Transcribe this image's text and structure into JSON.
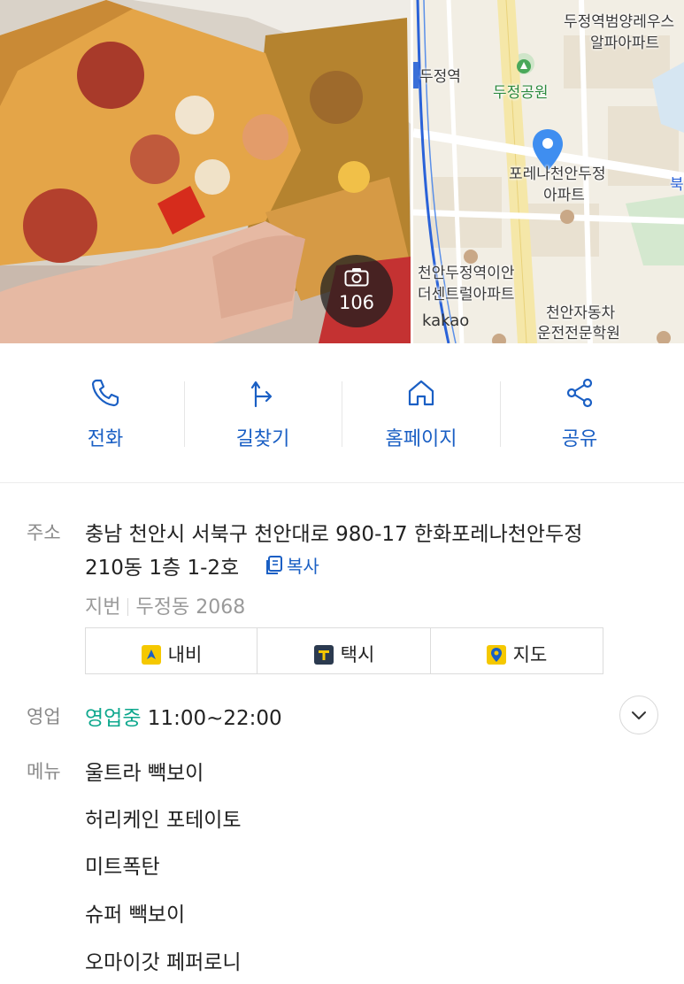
{
  "hero": {
    "photo_count": "106",
    "map": {
      "labels": [
        "두정역범양레우스",
        "알파아파트",
        "두정역",
        "두정공원",
        "포레나천안두정",
        "아파트",
        "천안두정역이안",
        "더센트럴아파트",
        "천안자동차",
        "운전전문학원",
        "북"
      ],
      "watermark": "kakao"
    }
  },
  "actions": [
    {
      "label": "전화",
      "icon": "phone-icon"
    },
    {
      "label": "길찾기",
      "icon": "directions-icon"
    },
    {
      "label": "홈페이지",
      "icon": "home-icon"
    },
    {
      "label": "공유",
      "icon": "share-icon"
    }
  ],
  "address": {
    "label": "주소",
    "line1": "충남 천안시 서북구 천안대로 980-17 한화포레나천안두정",
    "line2": "210동 1층 1-2호",
    "copy_label": "복사",
    "jibun_label": "지번",
    "jibun_value": "두정동 2068"
  },
  "nav_buttons": [
    {
      "label": "내비",
      "icon": "navi-icon",
      "color": "#f5c800"
    },
    {
      "label": "택시",
      "icon": "taxi-icon",
      "color": "#2b3a4f"
    },
    {
      "label": "지도",
      "icon": "map-pin-icon",
      "color": "#f5c800"
    }
  ],
  "hours": {
    "label": "영업",
    "status": "영업중",
    "time": "11:00~22:00"
  },
  "menu": {
    "label": "메뉴",
    "items": [
      "울트라 빽보이",
      "허리케인 포테이토",
      "미트폭탄",
      "슈퍼 빽보이",
      "오마이갓 페퍼로니"
    ]
  },
  "colors": {
    "accent": "#1a5fc4",
    "open": "#0fa88e",
    "pin": "#3f8ef0"
  }
}
